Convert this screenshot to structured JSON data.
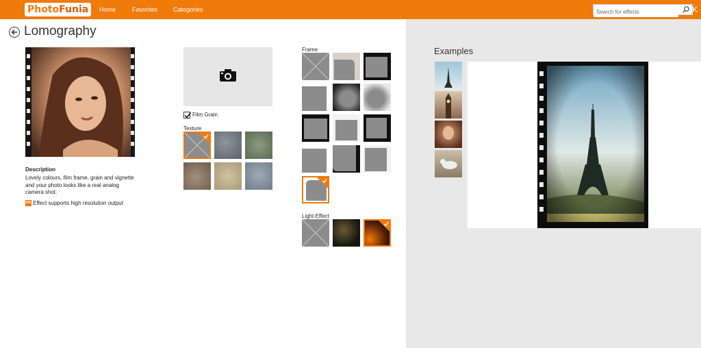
{
  "app": {
    "logo_part1": "Photo",
    "logo_part2": "Funia",
    "nav": [
      "Home",
      "Favorites",
      "Categories"
    ],
    "search_placeholder": "Search for effects",
    "close_glyph": "K",
    "accent_color": "#f07a0a"
  },
  "page": {
    "title": "Lomography",
    "description_heading": "Description",
    "description": "Lovely colours, film frame, grain and vignette and your photo looks like a real analog camera shot.",
    "hd_badge": "HD",
    "hd_text": "Effect supports high resolution output"
  },
  "options": {
    "film_grain_label": "Film Grain",
    "film_grain_checked": true,
    "texture_label": "Texture",
    "frame_label": "Frame",
    "light_effect_label": "Light Effect",
    "texture_selected_index": 0,
    "frame_selected_index": 12,
    "light_selected_index": 2
  },
  "examples": {
    "title": "Examples",
    "thumbs": [
      "eiffel-tower",
      "big-ben",
      "woman-portrait",
      "seagull"
    ]
  },
  "icons": {
    "back": "back-arrow-icon",
    "search": "search-icon",
    "camera": "camera-icon",
    "check": "checkmark-icon"
  }
}
